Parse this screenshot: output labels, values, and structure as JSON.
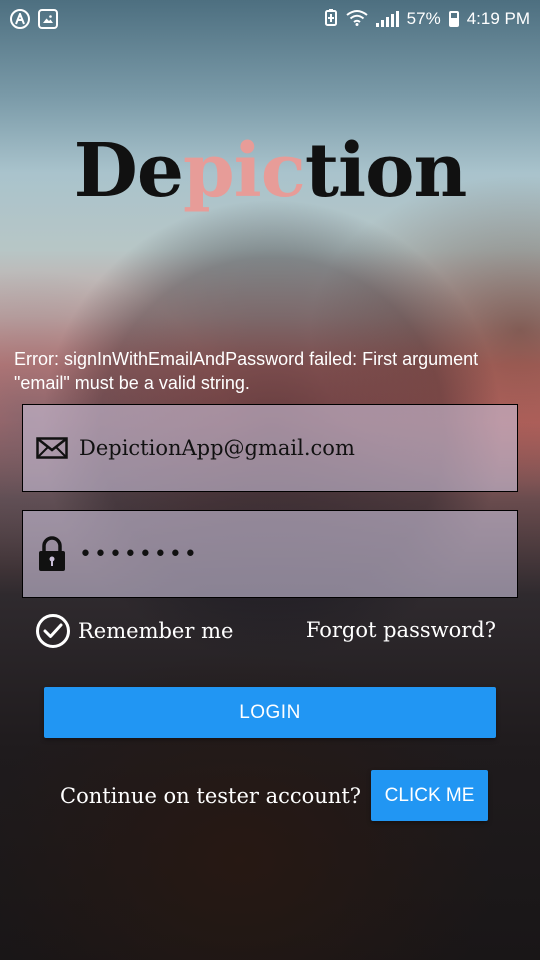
{
  "status_bar": {
    "battery_percent": "57%",
    "time": "4:19 PM",
    "icons": [
      "app-notification-icon",
      "image-notification-icon",
      "battery-saver-icon",
      "wifi-icon",
      "cell-signal-icon",
      "battery-icon"
    ]
  },
  "app": {
    "logo_prefix": "De",
    "logo_accent": "pic",
    "logo_suffix": "tion",
    "logo_color": "#111111",
    "accent_color": "#e79c98"
  },
  "error": {
    "message": "Error: signInWithEmailAndPassword failed: First argument \"email\" must be a valid string."
  },
  "form": {
    "email": {
      "value": "DepictionApp@gmail.com",
      "icon": "envelope-icon"
    },
    "password": {
      "value": "••••••••",
      "icon": "lock-icon"
    },
    "remember_label": "Remember me",
    "remember_checked": true,
    "forgot_label": "Forgot password?",
    "login_label": "LOGIN",
    "button_color": "#2196f3"
  },
  "tester": {
    "text": "Continue on tester account?",
    "button_label": "CLICK ME"
  }
}
